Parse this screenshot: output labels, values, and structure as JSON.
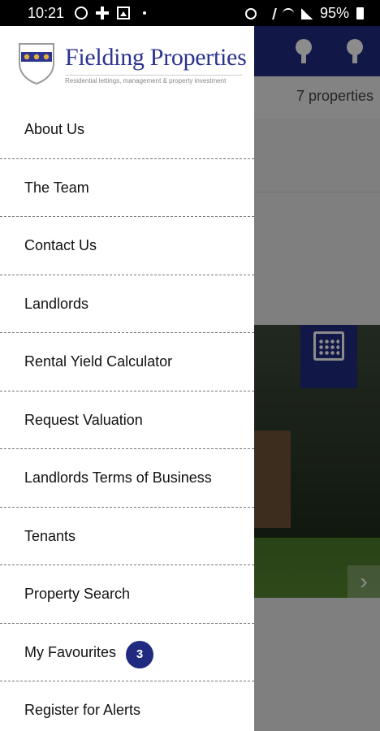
{
  "status_bar": {
    "time": "10:21",
    "battery": "95%"
  },
  "brand": {
    "name": "Fielding Properties",
    "tagline": "Residential lettings, management & property investment",
    "primary_color": "#1f2a80"
  },
  "background_app": {
    "property_count": "7 properties"
  },
  "menu": {
    "items": [
      {
        "label": "About Us"
      },
      {
        "label": "The Team"
      },
      {
        "label": "Contact Us"
      },
      {
        "label": "Landlords"
      },
      {
        "label": "Rental Yield Calculator"
      },
      {
        "label": "Request Valuation"
      },
      {
        "label": "Landlords Terms of Business"
      },
      {
        "label": "Tenants"
      },
      {
        "label": "Property Search"
      },
      {
        "label": "My Favourites",
        "badge": "3"
      },
      {
        "label": "Register for Alerts"
      }
    ]
  }
}
